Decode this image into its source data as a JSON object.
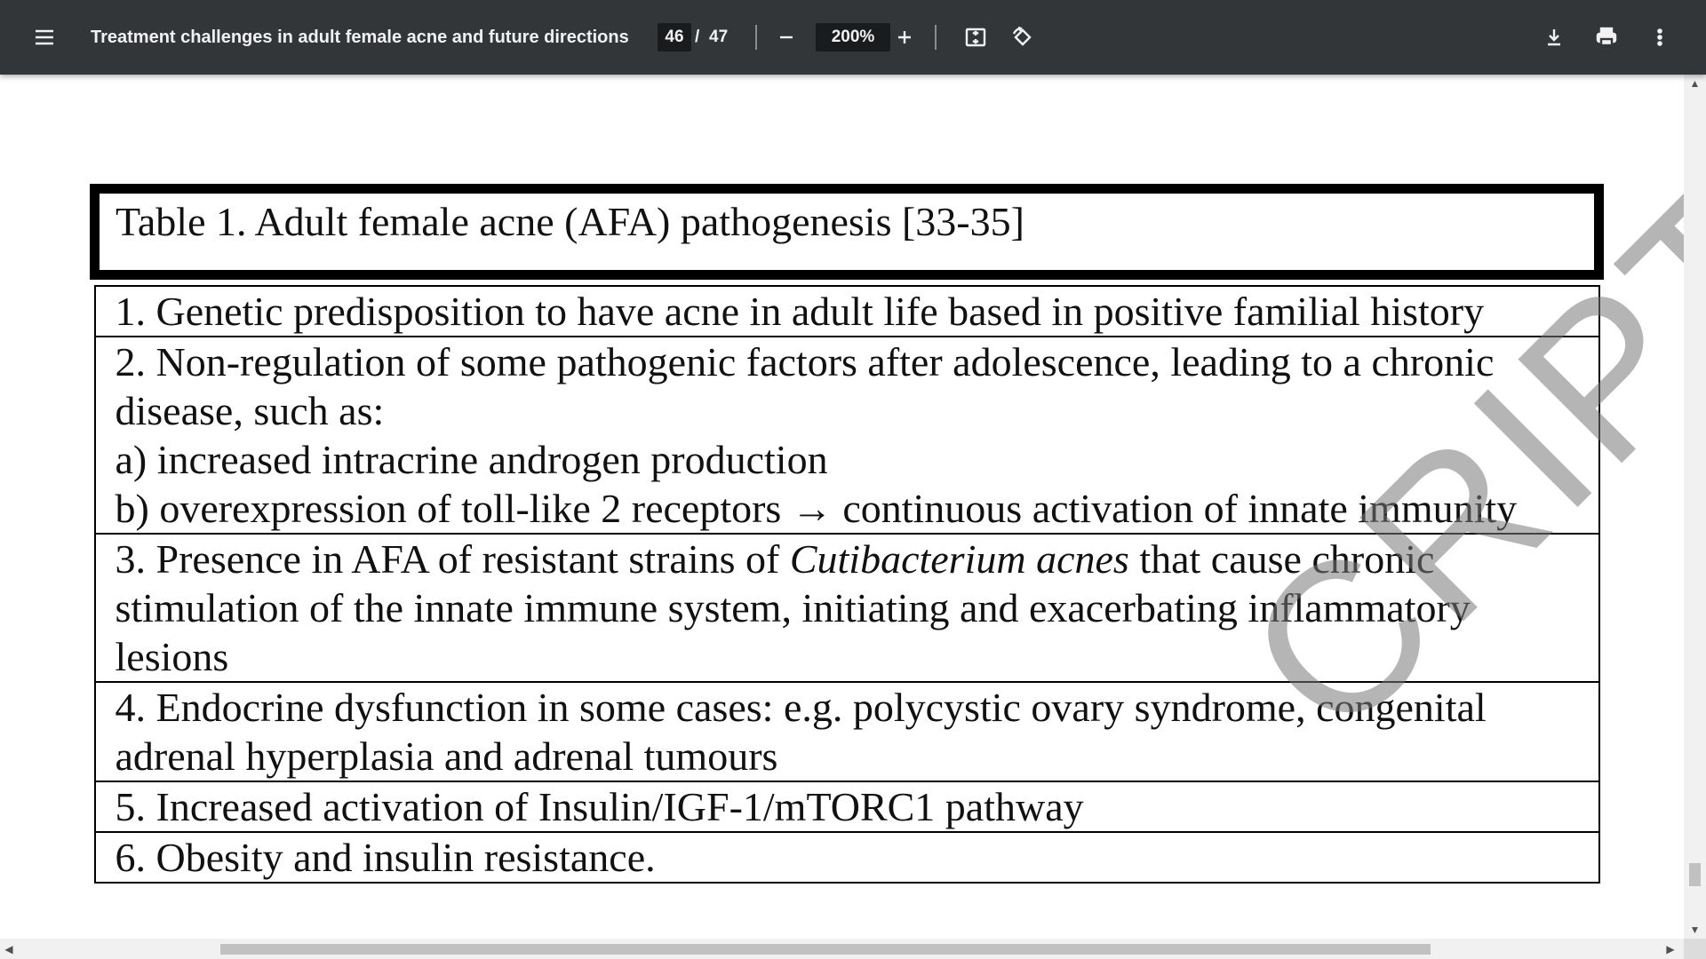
{
  "toolbar": {
    "title": "Treatment challenges in adult female acne and future directions",
    "page_current": "46",
    "page_separator": "/",
    "page_total": "47",
    "zoom": "200%",
    "icons": {
      "menu": "menu-icon",
      "zoom_out": "minus-icon",
      "zoom_in": "plus-icon",
      "fit": "fit-to-page-icon",
      "rotate": "rotate-icon",
      "download": "download-icon",
      "print": "print-icon",
      "more": "more-vert-icon"
    },
    "bg_color": "#323639"
  },
  "document": {
    "table_title": "Table 1. Adult female acne (AFA) pathogenesis [33-35]",
    "rows": [
      {
        "lines": [
          "1. Genetic predisposition to have acne in adult life based in positive familial history"
        ]
      },
      {
        "lines": [
          "2. Non-regulation of some pathogenic factors after adolescence, leading to a chronic",
          "disease, such as:",
          "a) increased intracrine androgen production",
          "b) overexpression of toll-like 2 receptors → continuous activation of innate immunity"
        ]
      },
      {
        "line1_before": "3. Presence in AFA of resistant strains of ",
        "line1_italic": "Cutibacterium acnes",
        "line1_after": " that cause chronic",
        "lines_rest": [
          "stimulation of the innate immune system, initiating and exacerbating inflammatory",
          "lesions"
        ]
      },
      {
        "lines": [
          "4. Endocrine dysfunction in some cases: e.g. polycystic ovary syndrome, congenital",
          "adrenal hyperplasia and adrenal tumours"
        ]
      },
      {
        "lines": [
          "5. Increased activation of Insulin/IGF-1/mTORC1 pathway"
        ]
      },
      {
        "lines": [
          "6. Obesity and insulin resistance."
        ]
      }
    ],
    "watermark": "CRIPT"
  }
}
